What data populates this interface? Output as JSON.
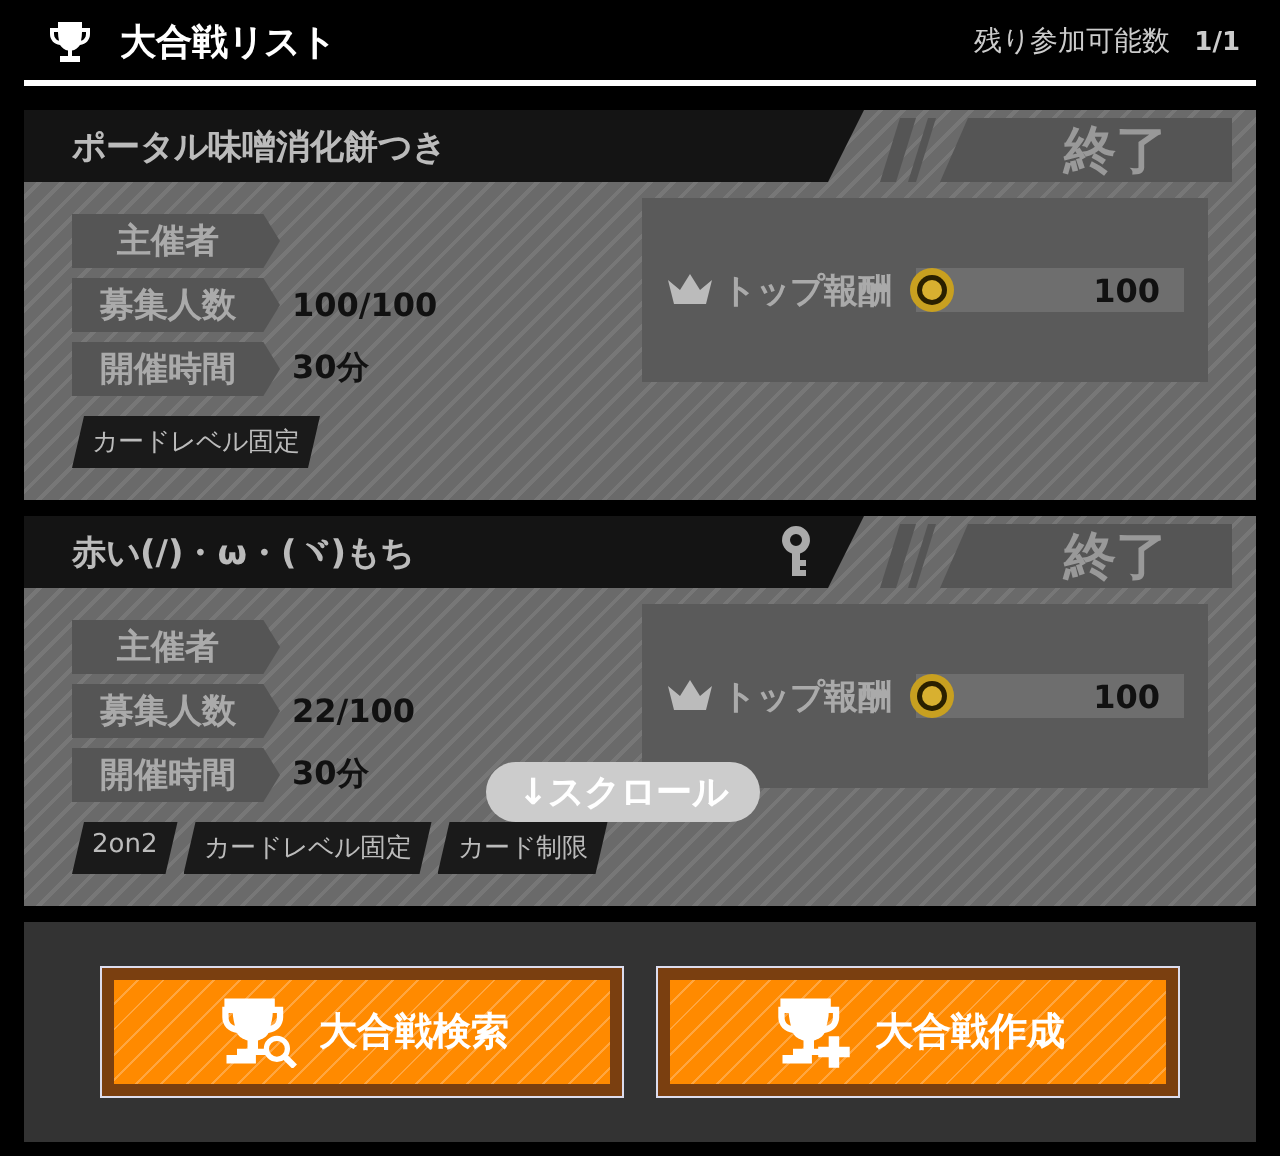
{
  "header": {
    "title": "大合戦リスト",
    "remaining_label": "残り参加可能数",
    "remaining_value": "1/1"
  },
  "battles": [
    {
      "title": "ポータル味噌消化餅つき",
      "locked": false,
      "status": "終了",
      "fields": [
        {
          "label": "主催者"
        },
        {
          "label": "募集人数",
          "value": "100/100"
        },
        {
          "label": "開催時間",
          "value": "30分"
        }
      ],
      "reward_label": "トップ報酬",
      "reward_value": "100",
      "tags": [
        "カードレベル固定"
      ]
    },
    {
      "title": "赤い(/)・ω・(ヾ)もち",
      "locked": true,
      "status": "終了",
      "fields": [
        {
          "label": "主催者"
        },
        {
          "label": "募集人数",
          "value": "22/100"
        },
        {
          "label": "開催時間",
          "value": "30分"
        }
      ],
      "reward_label": "トップ報酬",
      "reward_value": "100",
      "tags": [
        "2on2",
        "カードレベル固定",
        "カード制限"
      ]
    }
  ],
  "scroll_hint": "↓スクロール",
  "buttons": [
    {
      "kind": "search",
      "label": "大合戦検索"
    },
    {
      "kind": "create",
      "label": "大合戦作成"
    }
  ]
}
